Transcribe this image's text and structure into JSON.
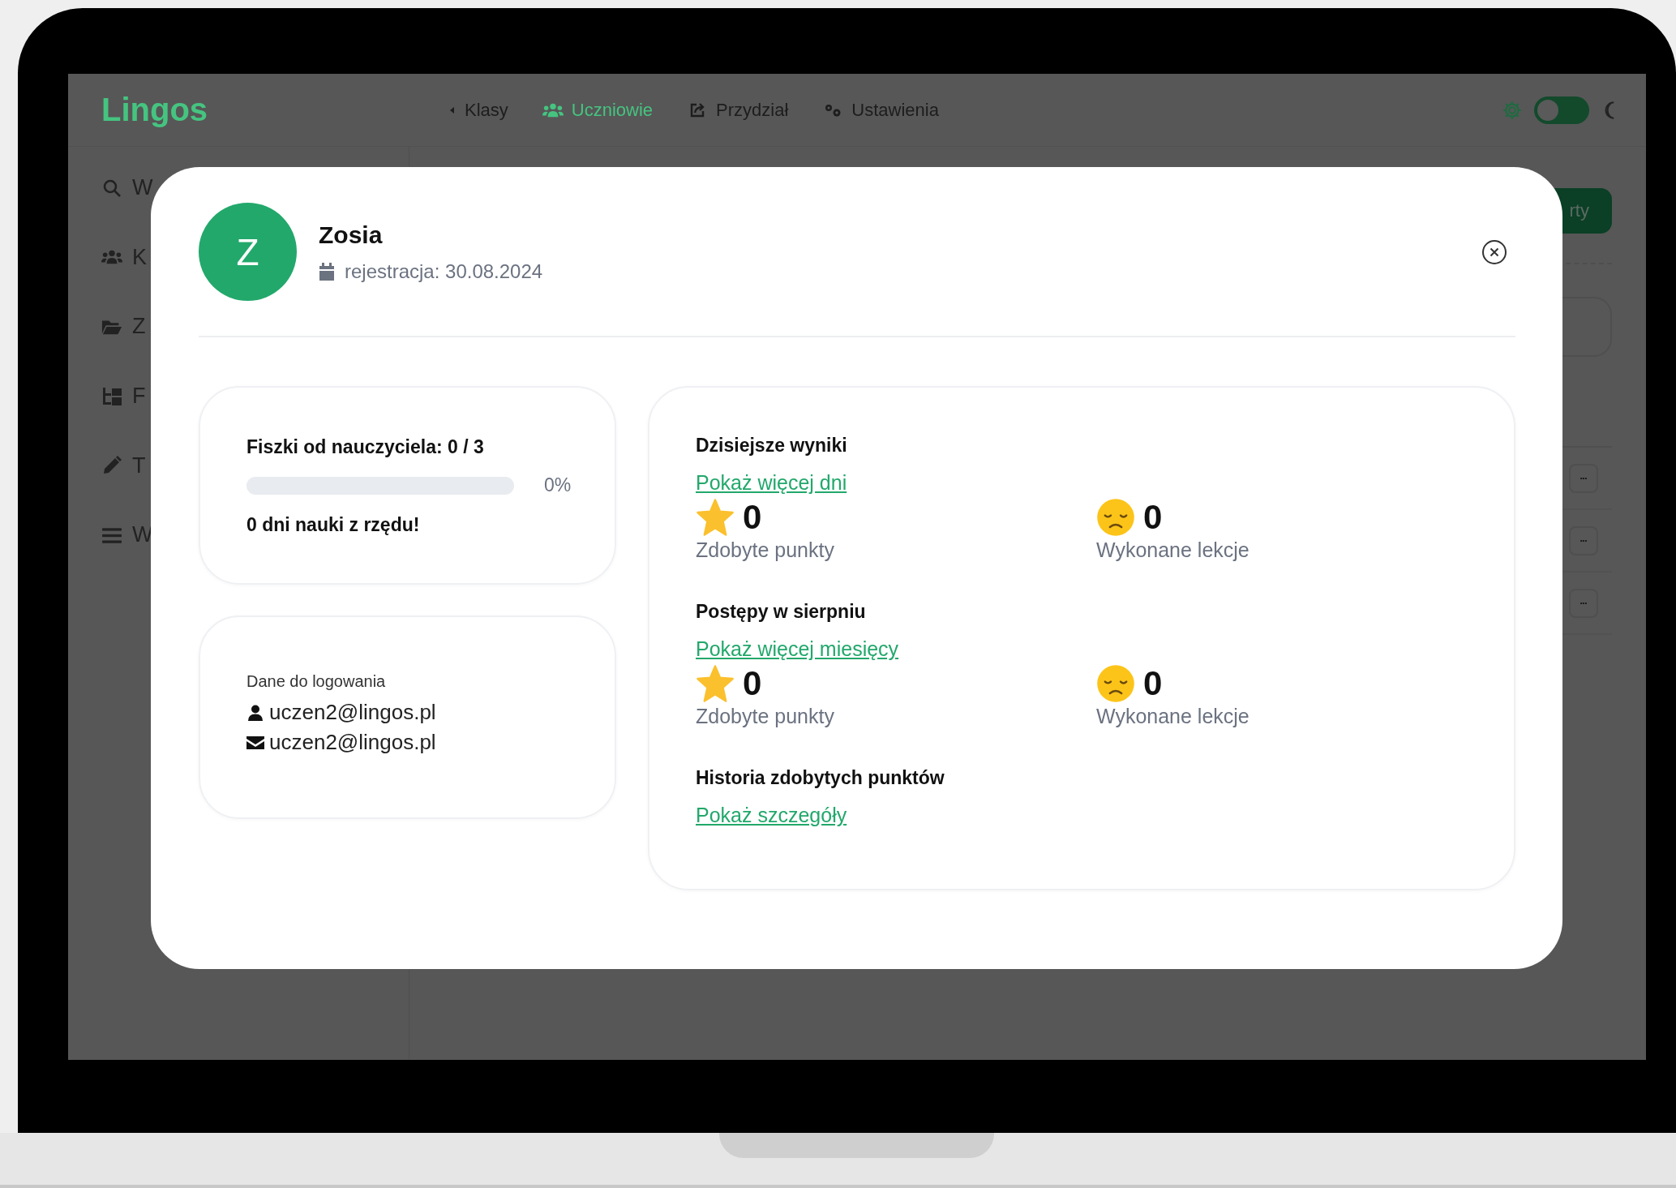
{
  "app": {
    "logo": "Lingos",
    "nav": [
      {
        "label": "Klasy",
        "selected": false
      },
      {
        "label": "Uczniowie",
        "selected": true
      },
      {
        "label": "Przydział",
        "selected": false
      },
      {
        "label": "Ustawienia",
        "selected": false
      }
    ],
    "dark_mode": false
  },
  "sidebar": {
    "items": [
      {
        "label": "W"
      },
      {
        "label": "K"
      },
      {
        "label": "Z"
      },
      {
        "label": "F"
      },
      {
        "label": "T"
      },
      {
        "label": "W"
      }
    ]
  },
  "background": {
    "button": "rty",
    "rows": [
      {
        "menu": "•••"
      },
      {
        "menu": "•••"
      },
      {
        "menu": "•••"
      }
    ]
  },
  "modal": {
    "avatar_letter": "Z",
    "name": "Zosia",
    "registered": "rejestracja: 30.08.2024",
    "flashcards": {
      "label": "Fiszki od nauczyciela: 0 / 3",
      "level": 0,
      "percent": "0%"
    },
    "streak": "0 dni nauki z rzędu!",
    "login": {
      "title": "Dane do logowania",
      "username": "uczen2@lingos.pl",
      "email": "uczen2@lingos.pl"
    },
    "sections": [
      {
        "title": "Dzisiejsze wyniki",
        "link": "Pokaż więcej dni",
        "stats": [
          {
            "kind": "points",
            "value": "0",
            "label": "Zdobyte punkty"
          },
          {
            "kind": "lessons",
            "value": "0",
            "label": "Wykonane lekcje"
          }
        ]
      },
      {
        "title": "Postępy w sierpniu",
        "link": "Pokaż więcej miesięcy",
        "stats": [
          {
            "kind": "points",
            "value": "0",
            "label": "Zdobyte punkty"
          },
          {
            "kind": "lessons",
            "value": "0",
            "label": "Wykonane lekcje"
          }
        ]
      },
      {
        "title": "Historia zdobytych punktów",
        "link": "Pokaż szczegóły"
      }
    ]
  }
}
